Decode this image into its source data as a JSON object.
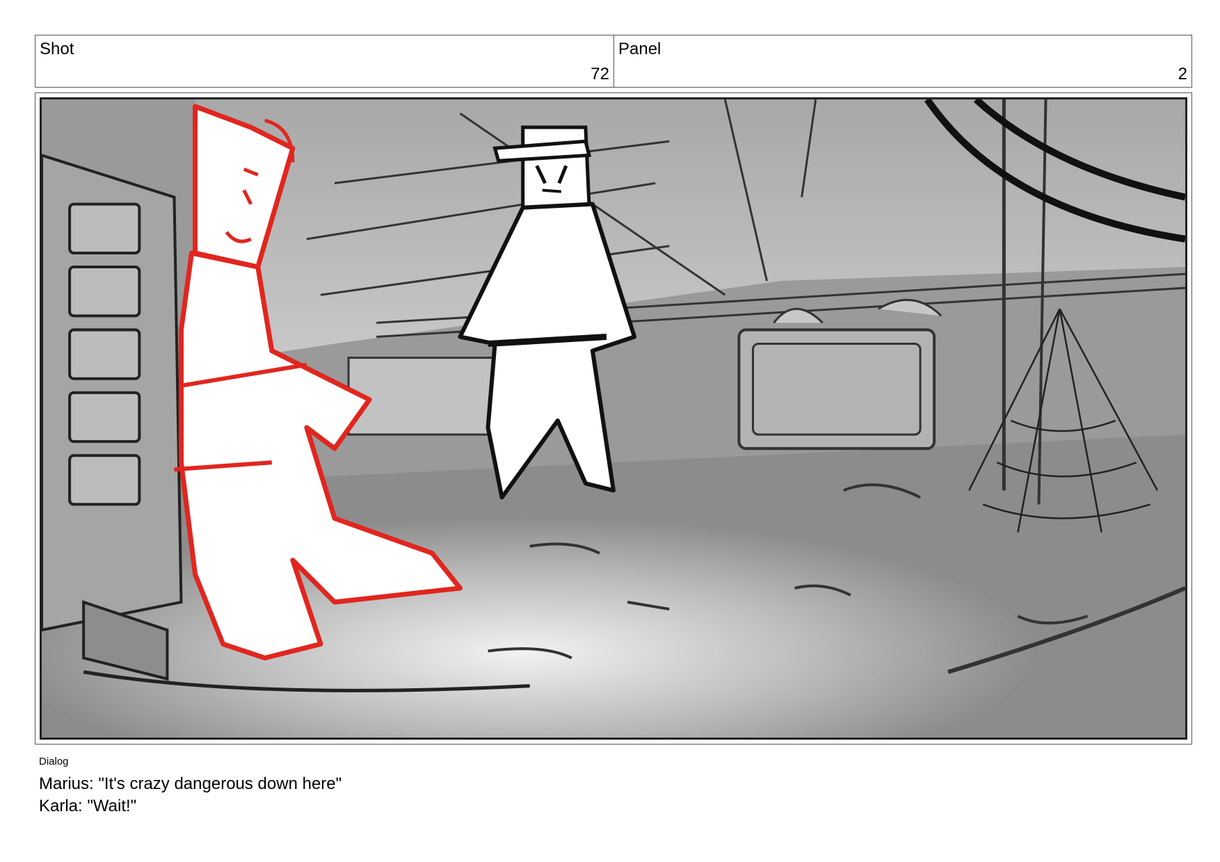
{
  "header": {
    "shot_label": "Shot",
    "shot_number": "72",
    "panel_label": "Panel",
    "panel_number": "2"
  },
  "dialog": {
    "label": "Dialog",
    "lines": [
      "Marius: \"It's crazy dangerous down here\"",
      "Karla: \"Wait!\""
    ]
  },
  "colors": {
    "red_sketch": "#e0261f",
    "black_sketch": "#111111",
    "background_gray": "#8f8f8f"
  }
}
